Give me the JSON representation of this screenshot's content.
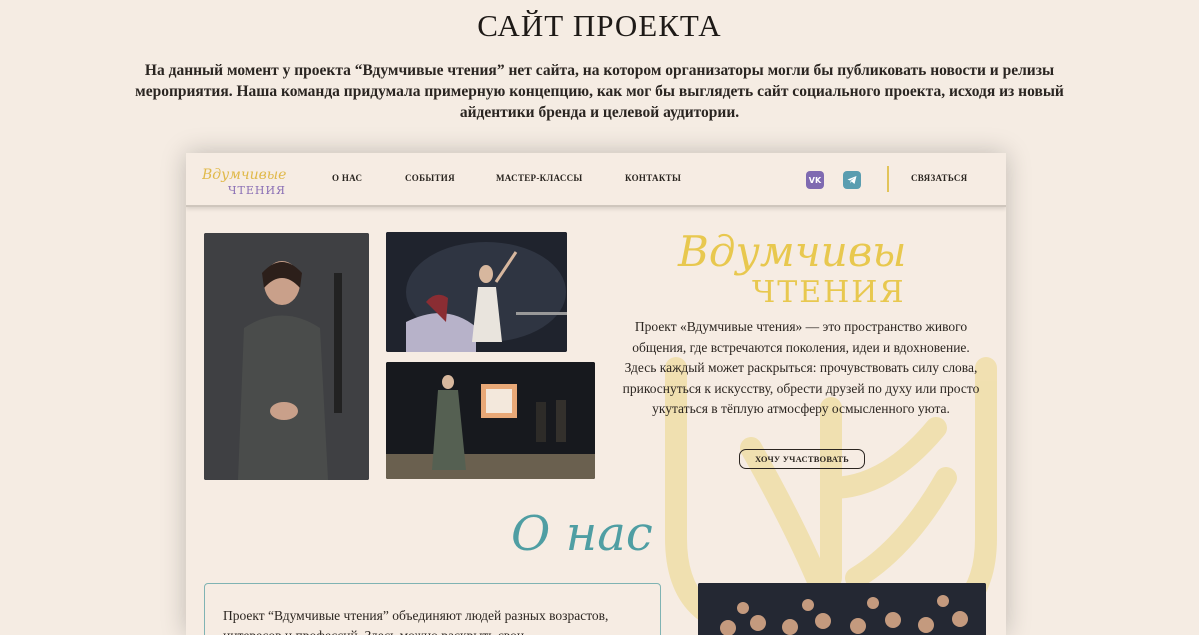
{
  "page": {
    "title": "САЙТ ПРОЕКТА",
    "intro": "На данный момент у проекта “Вдумчивые чтения” нет сайта, на котором организаторы могли бы публиковать новости и релизы мероприятия. Наша команда придумала примерную концепцию, как мог бы выглядеть сайт социального проекта, исходя из новый айдентики бренда и целевой аудитории."
  },
  "mockup": {
    "logo": {
      "line1": "Вдумчивые",
      "line2": "ЧТЕНИЯ"
    },
    "nav": {
      "items": [
        "О НАС",
        "СОБЫТИЯ",
        "МАСТЕР-КЛАССЫ",
        "КОНТАКТЫ"
      ],
      "contact_label": "СВЯЗАТЬСЯ",
      "vk_label": "VK"
    },
    "hero": {
      "logo_line1": "Вдумчивые",
      "logo_line2": "ЧТЕНИЯ",
      "text": "Проект «Вдумчивые чтения» — это пространство живого общения, где встречаются поколения, идеи и вдохновение. Здесь каждый может раскрыться: прочувствовать силу слова, прикоснуться к искусству, обрести друзей по духу или просто укутаться в тёплую атмосферу осмысленного уюта.",
      "cta_label": "ХОЧУ УЧАСТВОВАТЬ"
    },
    "about": {
      "title": "О нас",
      "text": "Проект “Вдумчивые чтения” объединяют людей разных возрастов, интересов и профессий. Здесь можно раскрыть свои"
    }
  },
  "colors": {
    "background": "#f5ece3",
    "gold": "#e8c84f",
    "teal": "#4f9ea3",
    "purple_vk": "#7f6ab1",
    "telegram": "#5a9db0"
  },
  "icons": [
    "vk-icon",
    "telegram-icon"
  ]
}
